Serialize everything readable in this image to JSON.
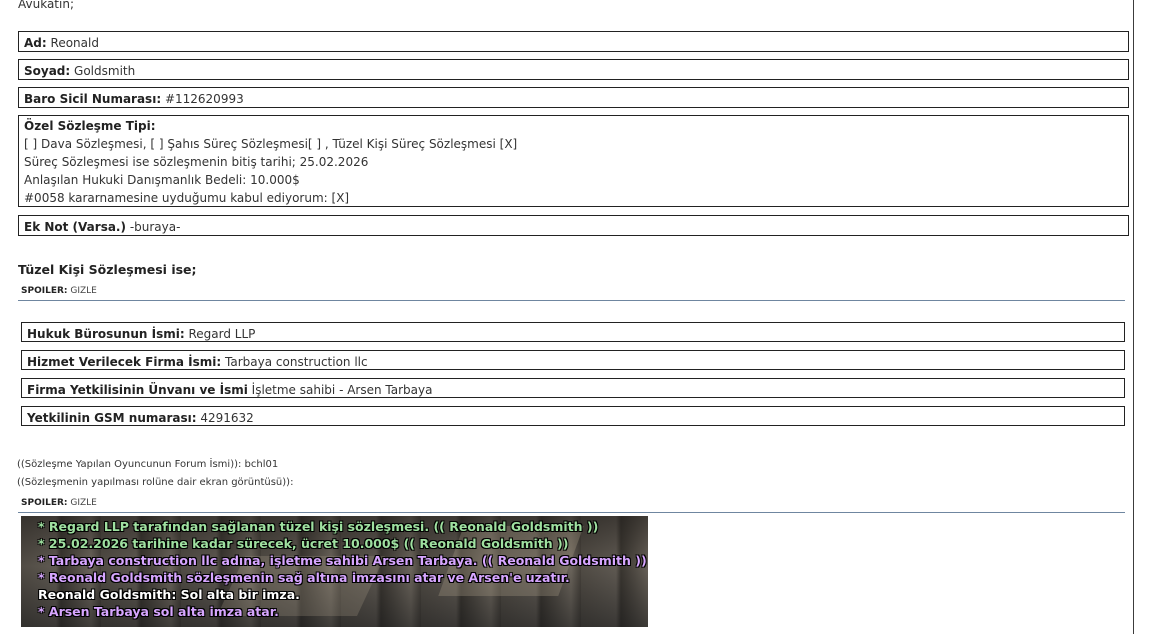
{
  "intro": "Avukatın;",
  "form": {
    "ad": {
      "label": "Ad:",
      "value": "Reonald"
    },
    "soyad": {
      "label": "Soyad:",
      "value": "Goldsmith"
    },
    "baro": {
      "label": "Baro Sicil Numarası:",
      "value": "#112620993"
    },
    "ozel": {
      "label": "Özel Sözleşme Tipi:",
      "line1": "[ ] Dava Sözleşmesi, [ ] Şahıs Süreç Sözleşmesi[ ] , Tüzel Kişi Süreç Sözleşmesi [X]",
      "line2": "Süreç Sözleşmesi ise sözleşmenin bitiş tarihi; 25.02.2026",
      "line3": "Anlaşılan Hukuki Danışmanlık Bedeli: 10.000$",
      "line4": "#0058 kararnamesine uyduğumu kabul ediyorum: [X]"
    },
    "eknot": {
      "label": "Ek Not (Varsa.)",
      "value": "-buraya-"
    }
  },
  "section_title": "Tüzel Kişi Sözleşmesi ise;",
  "spoiler1": {
    "label": "SPOILER:",
    "toggle": "GIZLE"
  },
  "company": {
    "hukuk": {
      "label": "Hukuk Bürosunun İsmi:",
      "value": "Regard LLP"
    },
    "hizmet": {
      "label": "Hizmet Verilecek Firma İsmi:",
      "value": "Tarbaya construction llc"
    },
    "firma": {
      "label": "Firma Yetkilisinin Ünvanı ve İsmi",
      "value": "İşletme sahibi - Arsen Tarbaya"
    },
    "gsm": {
      "label": "Yetkilinin GSM numarası:",
      "value": "4291632"
    }
  },
  "forum_name_line": "((Sözleşme Yapılan Oyuncunun Forum İsmi)): bchl01",
  "screenshot_line": "((Sözleşmenin yapılması rolüne dair ekran görüntüsü)):",
  "spoiler2": {
    "label": "SPOILER:",
    "toggle": "GIZLE"
  },
  "chat_lines": [
    "* Regard LLP tarafından sağlanan tüzel kişi sözleşmesi. (( Reonald Goldsmith ))",
    "* 25.02.2026 tarihine kadar sürecek, ücret 10.000$ (( Reonald Goldsmith ))",
    "* Tarbaya construction llc adına, işletme sahibi Arsen Tarbaya. (( Reonald Goldsmith ))",
    "* Reonald Goldsmith sözleşmenin sağ altına imzasını atar ve Arsen'e uzatır.",
    "Reonald Goldsmith: Sol alta bir imza.",
    "* Arsen Tarbaya sol alta imza atar."
  ],
  "colors": {
    "chat_action_green": "#9fe0a0",
    "chat_action_purple": "#d7a6ff",
    "chat_say_white": "#ffffff",
    "rule": "#6f86a0"
  }
}
